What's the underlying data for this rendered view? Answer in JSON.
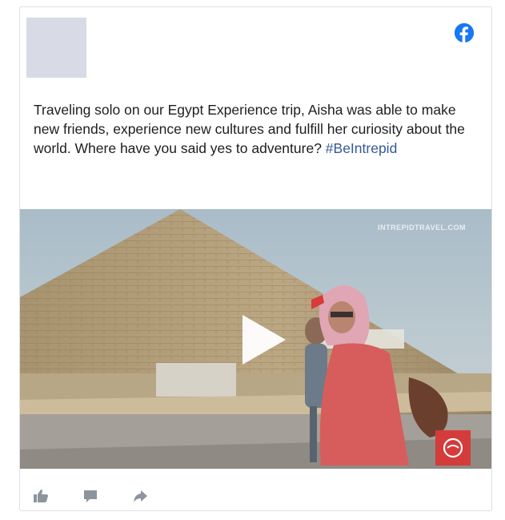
{
  "post": {
    "text": "Traveling solo on our Egypt Experience trip, Aisha was able to make new friends, experience new cultures and fulfill her curiosity about the world. Where have you said yes to adventure?",
    "hashtag": "#BeIntrepid"
  },
  "media": {
    "watermark": "INTREPIDTRAVEL.COM"
  },
  "icons": {
    "network": "facebook-icon",
    "play": "play-icon",
    "like": "like-icon",
    "comment": "comment-icon",
    "share": "share-icon"
  },
  "colors": {
    "brand": "#1877f2",
    "hashtag": "#365899",
    "action_icon": "#8d949e",
    "logo_badge": "#d43b3b"
  }
}
